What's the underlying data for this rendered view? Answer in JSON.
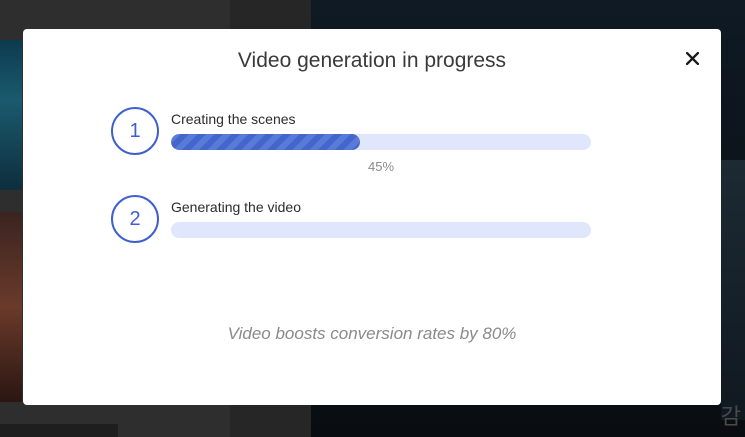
{
  "modal": {
    "title": "Video generation in progress",
    "close_icon": "close-icon",
    "tagline": "Video boosts conversion rates by 80%"
  },
  "steps": [
    {
      "number": "1",
      "label": "Creating the scenes",
      "progress": 0.45,
      "percent_text": "45%"
    },
    {
      "number": "2",
      "label": "Generating the video",
      "progress": 0
    }
  ],
  "background": {
    "text": "감"
  },
  "colors": {
    "accent": "#3f5fcf",
    "track": "#e0e6fb",
    "stripe_dark": "#4466cc",
    "stripe_light": "#5a7ad8",
    "muted_text": "#8a8a8a"
  }
}
